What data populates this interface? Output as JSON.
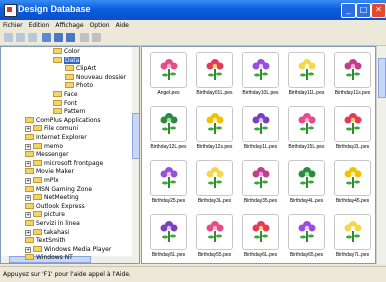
{
  "window": {
    "title": "Design Database"
  },
  "menu": [
    "Fichier",
    "Edition",
    "Affichage",
    "Option",
    "Aide"
  ],
  "tree": [
    {
      "label": "Color",
      "level": 3
    },
    {
      "label": "Data",
      "level": 3,
      "selected": true
    },
    {
      "label": "ClipArt",
      "level": 4
    },
    {
      "label": "Nouveau dossier",
      "level": 4
    },
    {
      "label": "Photo",
      "level": 4
    },
    {
      "label": "Face",
      "level": 3
    },
    {
      "label": "Font",
      "level": 3
    },
    {
      "label": "Pattern",
      "level": 3
    },
    {
      "label": "ComPlus Applications",
      "level": 1
    },
    {
      "label": "File comuni",
      "level": 1
    },
    {
      "label": "Internet Explorer",
      "level": 1
    },
    {
      "label": "memo",
      "level": 1
    },
    {
      "label": "Messenger",
      "level": 1
    },
    {
      "label": "microsoft frontpage",
      "level": 1
    },
    {
      "label": "Movie Maker",
      "level": 1
    },
    {
      "label": "mPlx",
      "level": 1
    },
    {
      "label": "MSN Gaming Zone",
      "level": 1
    },
    {
      "label": "NetMeeting",
      "level": 1
    },
    {
      "label": "Outlook Express",
      "level": 1
    },
    {
      "label": "picture",
      "level": 1
    },
    {
      "label": "Servizi in linea",
      "level": 1
    },
    {
      "label": "takahasi",
      "level": 1
    },
    {
      "label": "TextSmith",
      "level": 1
    },
    {
      "label": "Windows Media Player",
      "level": 1
    },
    {
      "label": "Windows NT",
      "level": 1
    }
  ],
  "files": [
    "Angel.pes",
    "Birthday01L.pes",
    "Birthday10L.pes",
    "Birthday11L.pes",
    "Birthday11s.pes",
    "Birthday12L.pes",
    "Birthday12s.pes",
    "Birthday1L.pes",
    "Birthday15L.pes",
    "Birthday2L.pes",
    "Birthday25.pes",
    "Birthday3L.pes",
    "Birthday35.pes",
    "Birthday4L.pes",
    "Birthday45.pes",
    "Birthday5L.pes",
    "Birthday55.pes",
    "Birthday6L.pes",
    "Birthday65.pes",
    "Birthday7L.pes"
  ],
  "status": {
    "text": "Appuyez sur 'F1' pour l'aide appel à l'Aide."
  },
  "colors": {
    "titlebar": "#0b5ddf",
    "selection": "#316ac5",
    "folder": "#f3d36b"
  }
}
